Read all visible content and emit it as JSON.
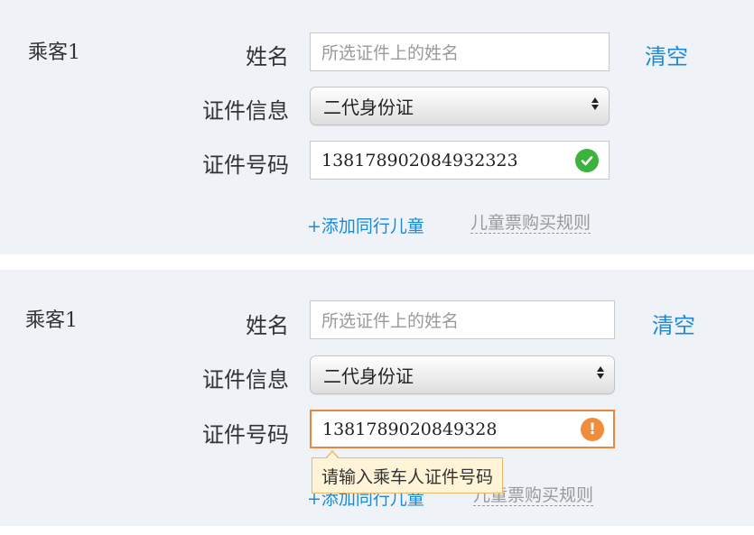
{
  "panel1": {
    "passenger_label": "乘客1",
    "name_label": "姓名",
    "name_placeholder": "所选证件上的姓名",
    "clear_label": "清空",
    "id_type_label": "证件信息",
    "id_type_value": "二代身份证",
    "id_number_label": "证件号码",
    "id_number_value": "138178902084932323",
    "id_status": "valid",
    "add_child_label": "+添加同行儿童",
    "child_rules_label": "儿童票购买规则"
  },
  "panel2": {
    "passenger_label": "乘客1",
    "name_label": "姓名",
    "name_placeholder": "所选证件上的姓名",
    "clear_label": "清空",
    "id_type_label": "证件信息",
    "id_type_value": "二代身份证",
    "id_number_label": "证件号码",
    "id_number_value": "1381789020849328",
    "id_status": "error",
    "warn_glyph": "!",
    "tooltip_text": "请输入乘车人证件号码",
    "add_child_label": "+添加同行儿童",
    "child_rules_label": "儿童票购买规则"
  },
  "colors": {
    "panel_bg": "#eff3f7",
    "link": "#1b8ad6",
    "valid": "#3cb33c",
    "error": "#f08d3c",
    "tooltip_bg": "#fff4d8"
  }
}
